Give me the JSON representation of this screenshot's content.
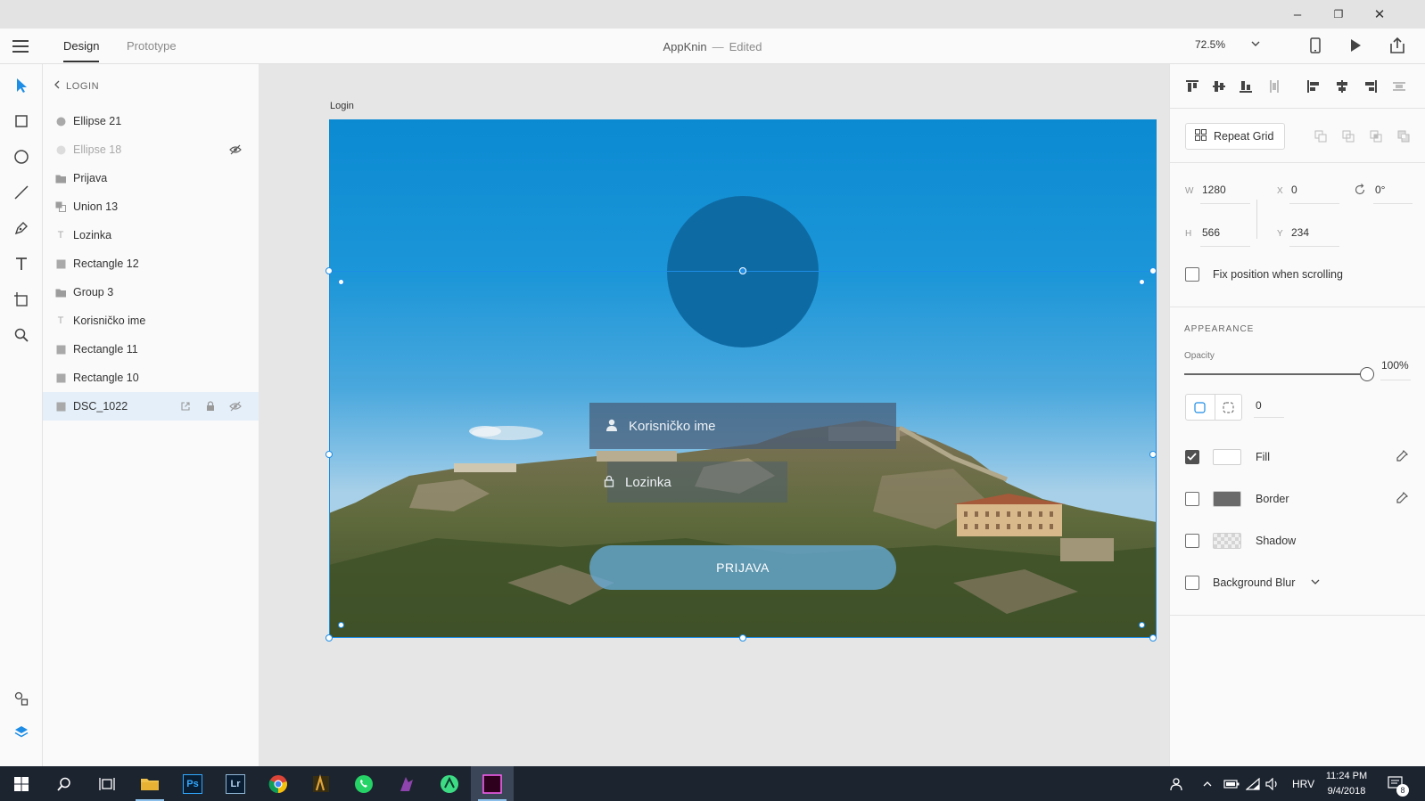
{
  "app": {
    "window_title": "AppKnin",
    "edit_state": "Edited",
    "tabs": [
      {
        "label": "Design",
        "active": true
      },
      {
        "label": "Prototype",
        "active": false
      }
    ],
    "zoom": "72.5%"
  },
  "window_controls": {
    "minimize": "–",
    "restore": "❐",
    "close": "✕"
  },
  "tools": [
    "select-icon",
    "rectangle-icon",
    "ellipse-icon",
    "line-icon",
    "pen-icon",
    "text-icon",
    "artboard-icon",
    "zoom-icon",
    "assets-icon",
    "layers-icon"
  ],
  "layers": {
    "back_label": "LOGIN",
    "items": [
      {
        "label": "Ellipse 21",
        "icon": "ellipse-icon",
        "muted": false
      },
      {
        "label": "Ellipse 18",
        "icon": "ellipse-icon",
        "muted": true
      },
      {
        "label": "Prijava",
        "icon": "folder-icon",
        "muted": false
      },
      {
        "label": "Union 13",
        "icon": "union-icon",
        "muted": false
      },
      {
        "label": "Lozinka",
        "icon": "text-icon",
        "muted": false
      },
      {
        "label": "Rectangle 12",
        "icon": "rectangle-icon",
        "muted": false
      },
      {
        "label": "Group 3",
        "icon": "folder-icon",
        "muted": false
      },
      {
        "label": "Korisničko ime",
        "icon": "text-icon",
        "muted": false
      },
      {
        "label": "Rectangle 11",
        "icon": "rectangle-icon",
        "muted": false
      },
      {
        "label": "Rectangle 10",
        "icon": "rectangle-icon",
        "muted": false
      },
      {
        "label": "DSC_1022",
        "icon": "image-icon",
        "muted": false,
        "selected": true
      }
    ]
  },
  "canvas": {
    "artboard_name": "Login",
    "username_placeholder": "Korisničko ime",
    "password_placeholder": "Lozinka",
    "login_button": "PRIJAVA"
  },
  "properties": {
    "repeat_grid": "Repeat Grid",
    "w_label": "W",
    "w_value": "1280",
    "x_label": "X",
    "x_value": "0",
    "h_label": "H",
    "h_value": "566",
    "y_label": "Y",
    "y_value": "234",
    "rotation": "0°",
    "fix_position": "Fix position when scrolling",
    "fix_position_checked": false,
    "appearance_title": "APPEARANCE",
    "opacity_label": "Opacity",
    "opacity_value": "100%",
    "opacity_fraction": 1.0,
    "corner_radius": "0",
    "fill_label": "Fill",
    "fill_checked": true,
    "fill_color": "#ffffff",
    "border_label": "Border",
    "border_checked": false,
    "border_color": "#6a6a6a",
    "shadow_label": "Shadow",
    "shadow_checked": false,
    "blur_label": "Background Blur",
    "blur_checked": false
  },
  "taskbar": {
    "apps": [
      "windows-start-icon",
      "search-icon",
      "task-view-icon",
      "file-explorer-icon",
      "photoshop-icon",
      "lightroom-icon",
      "chrome-icon",
      "bridge-icon",
      "whatsapp-icon",
      "app-icon",
      "android-studio-icon",
      "xd-icon"
    ],
    "photoshop_label": "Ps",
    "lightroom_label": "Lr",
    "language": "HRV",
    "time": "11:24 PM",
    "date": "9/4/2018",
    "notifications": "8"
  },
  "colors": {
    "accent": "#1d8de6",
    "selection_bg": "#e4eff9",
    "taskbar": "#1c2430"
  }
}
